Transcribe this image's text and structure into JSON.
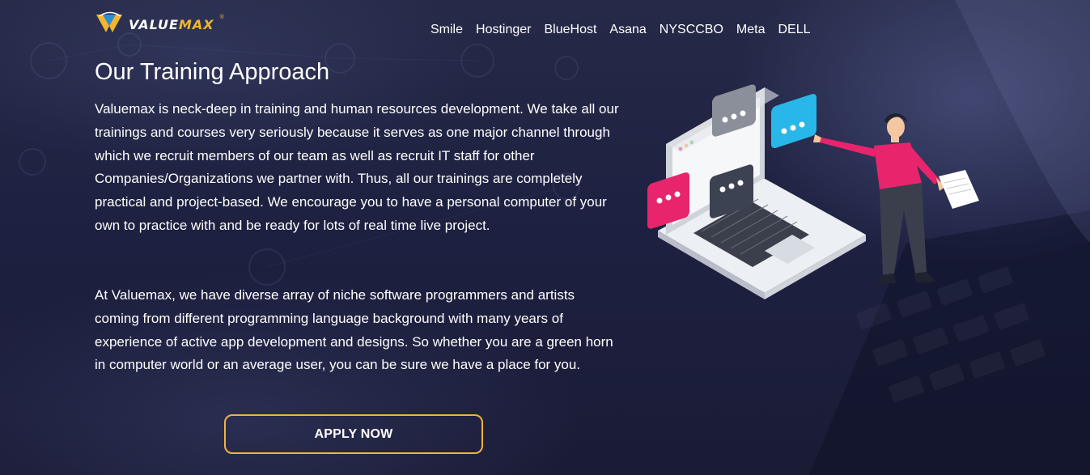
{
  "brand": {
    "logo_text_main": "VALUE",
    "logo_text_accent": "MAX",
    "logo_registered": "®"
  },
  "nav": {
    "items": [
      "Smile",
      "Hostinger",
      "BlueHost",
      "Asana",
      "NYSCCBO",
      "Meta",
      "DELL"
    ]
  },
  "section": {
    "title": "Our Training Approach",
    "paragraph1": "Valuemax is neck-deep in training and human resources development. We take all our trainings and courses very seriously because it serves as one major channel through which we recruit members of our team as well as recruit IT staff for other Companies/Organizations we partner with. Thus, all our trainings are completely practical and project-based. We encourage you to have a personal computer of your own to practice with and be ready for lots of real time live project.",
    "paragraph2": "At Valuemax, we have diverse array of niche software programmers and artists coming from different programming language background with many years of experience of active app development and designs. So whether you are a green horn in computer world or an average user, you can be sure we have a place for you.",
    "apply_label": "APPLY NOW"
  },
  "colors": {
    "accent": "#f0b43a",
    "background": "#1d2040",
    "illustration_pink": "#e8246d",
    "illustration_cyan": "#29b6e8"
  },
  "icons": {
    "logo": "valuemax-logo-icon",
    "illustration": "laptop-chat-bubbles-person-illustration"
  }
}
